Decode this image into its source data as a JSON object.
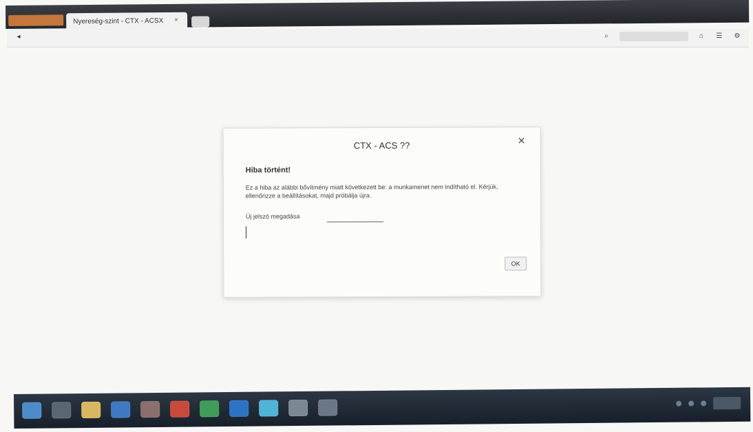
{
  "browser": {
    "tab": {
      "title": "Nyereség-szint - CTX - ACSX",
      "close": "×"
    },
    "url": "",
    "icons": {
      "back": "◂",
      "search": "⌕",
      "menu": "☰",
      "home": "⌂",
      "settings": "⚙"
    }
  },
  "dialog": {
    "title": "CTX - ACS ??",
    "close": "✕",
    "heading": "Hiba történt!",
    "message": "Ez a hiba az alábbi bővítmény miatt következett be: a munkamenet nem indítható el. Kérjük, ellenőrizze a beállításokat, majd próbálja újra.",
    "field_label": "Új jelszó megadása",
    "input_value": "",
    "ok_label": "OK"
  },
  "colors": {
    "browser_chrome": "#2f343a",
    "dialog_bg": "#fcfcfb",
    "taskbar": "#1f2a36",
    "accent_orange": "#c4763b"
  },
  "taskbar": {
    "icons": [
      "windows-logo-icon",
      "search-icon",
      "folder-icon",
      "media-icon",
      "paint-icon",
      "app-icon-red",
      "app-icon-green",
      "app-icon-blue",
      "app-icon-cyan",
      "calendar-icon",
      "settings-icon"
    ]
  }
}
